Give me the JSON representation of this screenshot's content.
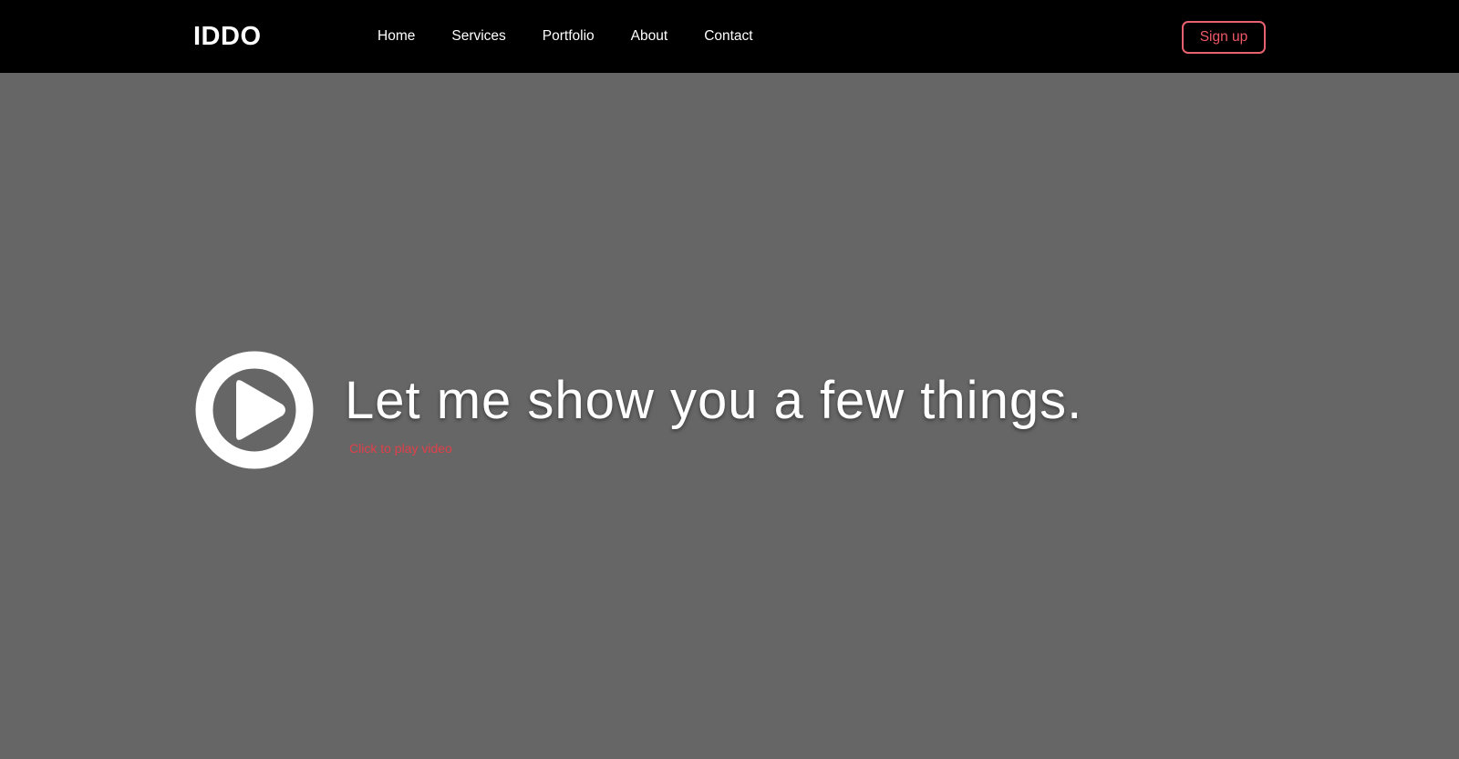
{
  "header": {
    "logo": "IDDO",
    "nav": [
      {
        "label": "Home"
      },
      {
        "label": "Services"
      },
      {
        "label": "Portfolio"
      },
      {
        "label": "About"
      },
      {
        "label": "Contact"
      }
    ],
    "signup_label": "Sign up"
  },
  "hero": {
    "headline": "Let me show you a few things.",
    "subtext": "Click to play video",
    "play_icon": "play-circle-icon"
  },
  "colors": {
    "header_bg": "#000000",
    "hero_bg": "#666666",
    "accent": "#ee5866",
    "text": "#ffffff"
  }
}
